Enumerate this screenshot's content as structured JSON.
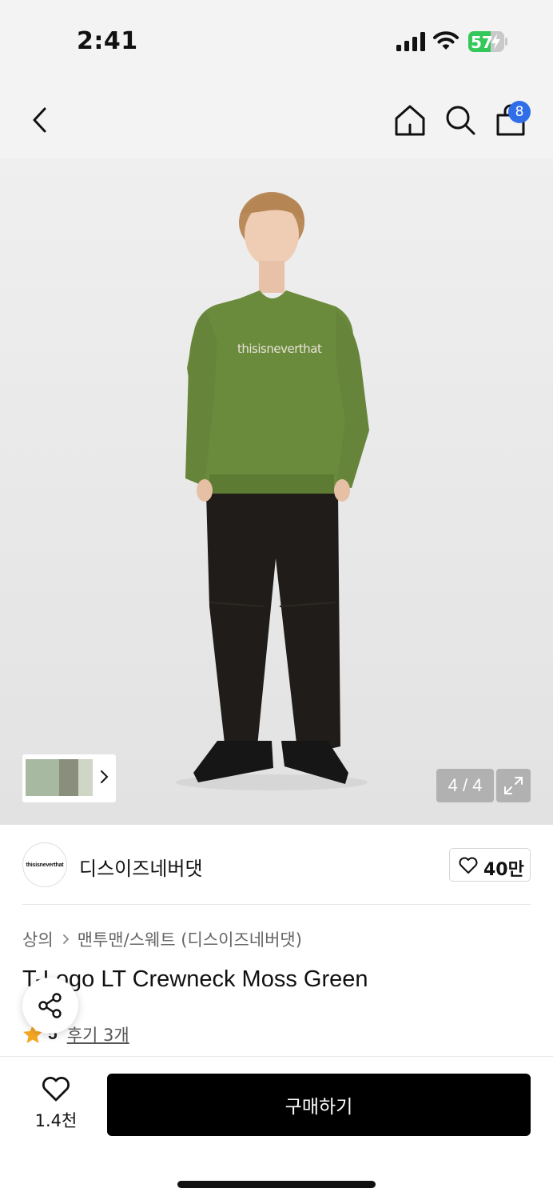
{
  "status_bar": {
    "time": "2:41",
    "battery_level": "57",
    "icons": [
      "signal-icon",
      "wifi-icon",
      "battery-charging-icon"
    ]
  },
  "header": {
    "icons": [
      "chevron-left-icon",
      "home-icon",
      "search-icon",
      "shopping-bag-icon"
    ],
    "cart_badge": "8"
  },
  "gallery": {
    "counter": "4 / 4",
    "thumbnail_colors": [
      "#a7b9a0",
      "#8a8f7d",
      "#cfd6c5"
    ],
    "icons": [
      "chevron-right-icon",
      "expand-icon"
    ]
  },
  "brand": {
    "logo_text": "thisisneverthat",
    "name": "디스이즈네버댓",
    "like_count": "40만"
  },
  "product": {
    "breadcrumb": [
      "상의",
      "맨투맨/스웨트 (디스이즈네버댓)"
    ],
    "title": "T-Logo LT Crewneck Moss Green",
    "rating": "5",
    "review_link": "후기 3개"
  },
  "bottom_bar": {
    "wish_count": "1.4천",
    "buy_label": "구매하기"
  },
  "colors": {
    "accent_badge": "#2f6ee8",
    "buy_button": "#000000",
    "star": "#f5a623",
    "battery": "#34c759"
  }
}
